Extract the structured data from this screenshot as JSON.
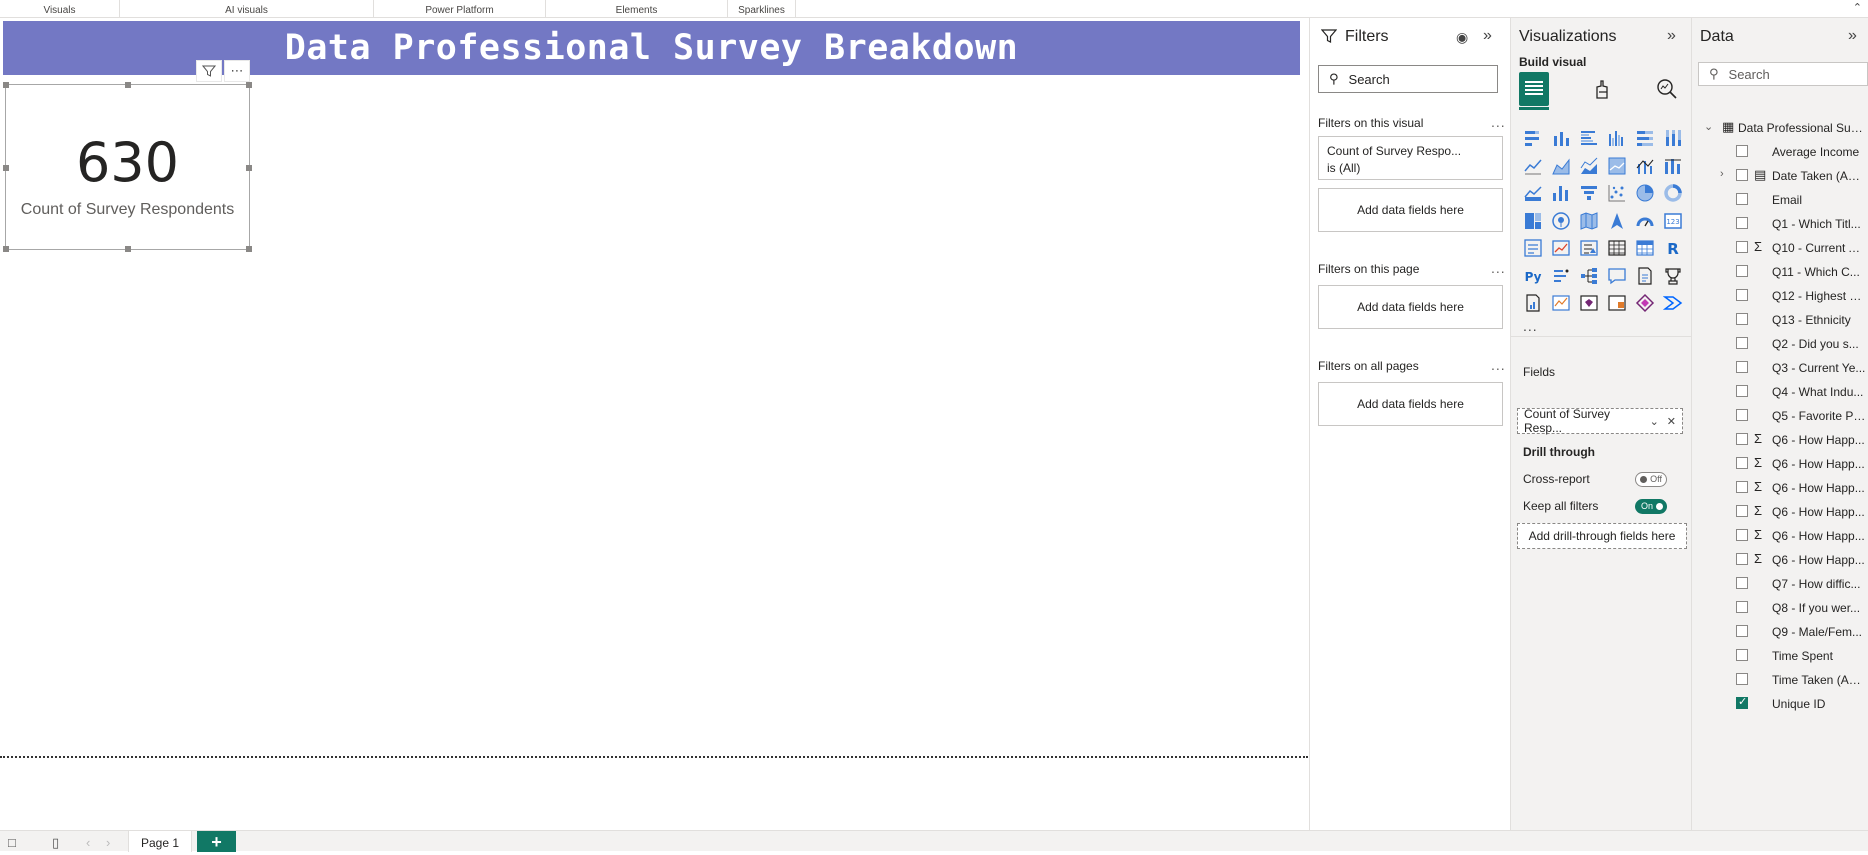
{
  "ribbon": {
    "groups": [
      "Visuals",
      "AI visuals",
      "Power Platform",
      "Elements",
      "Sparklines"
    ],
    "collapse_icon": "chevron-up-icon"
  },
  "report": {
    "title": "Data Professional Survey Breakdown",
    "card": {
      "value": "630",
      "label": "Count of Survey Respondents"
    }
  },
  "bottom": {
    "page_tab": "Page 1",
    "add_label": "+"
  },
  "filters": {
    "title": "Filters",
    "search_placeholder": "Search",
    "on_visual_title": "Filters on this visual",
    "visual_filter_line1": "Count of Survey Respo...",
    "visual_filter_line2": "is (All)",
    "add_fields": "Add data fields here",
    "on_page_title": "Filters on this page",
    "all_pages_title": "Filters on all pages",
    "more": "..."
  },
  "viz": {
    "title": "Visualizations",
    "build_label": "Build visual",
    "more_visuals": "...",
    "fields_label": "Fields",
    "field_pill": "Count of Survey Resp...",
    "drill_label": "Drill through",
    "cross_report": "Cross-report",
    "cross_report_state": "Off",
    "keep_filters": "Keep all filters",
    "keep_filters_state": "On",
    "drill_box": "Add drill-through fields here",
    "accent": "#117865"
  },
  "data": {
    "title": "Data",
    "search_placeholder": "Search",
    "table_name": "Data Professional Surv...",
    "fields": [
      {
        "name": "Average Income",
        "sigma": false,
        "expand": false,
        "checked": false
      },
      {
        "name": "Date Taken (Am...",
        "sigma": false,
        "expand": true,
        "checked": false,
        "hier": true
      },
      {
        "name": "Email",
        "sigma": false,
        "expand": false,
        "checked": false
      },
      {
        "name": "Q1 - Which Titl...",
        "sigma": false,
        "expand": false,
        "checked": false
      },
      {
        "name": "Q10 - Current A...",
        "sigma": true,
        "expand": false,
        "checked": false
      },
      {
        "name": "Q11 - Which C...",
        "sigma": false,
        "expand": false,
        "checked": false
      },
      {
        "name": "Q12 - Highest L...",
        "sigma": false,
        "expand": false,
        "checked": false
      },
      {
        "name": "Q13 - Ethnicity",
        "sigma": false,
        "expand": false,
        "checked": false
      },
      {
        "name": "Q2 - Did you s...",
        "sigma": false,
        "expand": false,
        "checked": false
      },
      {
        "name": "Q3 - Current Ye...",
        "sigma": false,
        "expand": false,
        "checked": false
      },
      {
        "name": "Q4 - What Indu...",
        "sigma": false,
        "expand": false,
        "checked": false
      },
      {
        "name": "Q5 - Favorite Pr...",
        "sigma": false,
        "expand": false,
        "checked": false
      },
      {
        "name": "Q6 - How Happ...",
        "sigma": true,
        "expand": false,
        "checked": false
      },
      {
        "name": "Q6 - How Happ...",
        "sigma": true,
        "expand": false,
        "checked": false
      },
      {
        "name": "Q6 - How Happ...",
        "sigma": true,
        "expand": false,
        "checked": false
      },
      {
        "name": "Q6 - How Happ...",
        "sigma": true,
        "expand": false,
        "checked": false
      },
      {
        "name": "Q6 - How Happ...",
        "sigma": true,
        "expand": false,
        "checked": false
      },
      {
        "name": "Q6 - How Happ...",
        "sigma": true,
        "expand": false,
        "checked": false
      },
      {
        "name": "Q7 - How diffic...",
        "sigma": false,
        "expand": false,
        "checked": false
      },
      {
        "name": "Q8 - If you wer...",
        "sigma": false,
        "expand": false,
        "checked": false
      },
      {
        "name": "Q9 - Male/Fem...",
        "sigma": false,
        "expand": false,
        "checked": false
      },
      {
        "name": "Time Spent",
        "sigma": false,
        "expand": false,
        "checked": false
      },
      {
        "name": "Time Taken (Am...",
        "sigma": false,
        "expand": false,
        "checked": false
      },
      {
        "name": "Unique ID",
        "sigma": false,
        "expand": false,
        "checked": true
      }
    ]
  }
}
